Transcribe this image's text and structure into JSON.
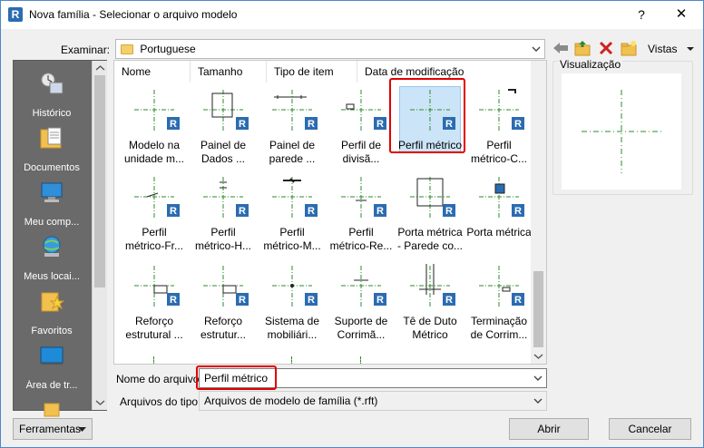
{
  "window": {
    "title": "Nova família - Selecionar o arquivo modelo",
    "help_label": "?",
    "close_label": "✕"
  },
  "lookin": {
    "label": "Examinar:",
    "value": "Portuguese"
  },
  "toolbar": {
    "views_label": "Vistas"
  },
  "places": [
    {
      "label": "Histórico",
      "icon": "history-icon"
    },
    {
      "label": "Documentos",
      "icon": "documents-icon"
    },
    {
      "label": "Meu comp...",
      "icon": "computer-icon"
    },
    {
      "label": "Meus locai...",
      "icon": "network-icon"
    },
    {
      "label": "Favoritos",
      "icon": "favorites-icon"
    },
    {
      "label": "Área de tr...",
      "icon": "desktop-icon"
    }
  ],
  "columns": [
    "Nome",
    "Tamanho",
    "Tipo de item",
    "Data de modificação"
  ],
  "files": [
    {
      "line1": "Modelo na",
      "line2": "unidade m..."
    },
    {
      "line1": "Painel de",
      "line2": "Dados ..."
    },
    {
      "line1": "Painel de",
      "line2": "parede ..."
    },
    {
      "line1": "Perfil de",
      "line2": "divisã..."
    },
    {
      "line1": "Perfil métrico",
      "line2": ""
    },
    {
      "line1": "Perfil",
      "line2": "métrico-C..."
    },
    {
      "line1": "Perfil",
      "line2": "métrico-Fr..."
    },
    {
      "line1": "Perfil",
      "line2": "métrico-H..."
    },
    {
      "line1": "Perfil",
      "line2": "métrico-M..."
    },
    {
      "line1": "Perfil",
      "line2": "métrico-Re..."
    },
    {
      "line1": "Porta métrica",
      "line2": "- Parede co..."
    },
    {
      "line1": "Porta métrica",
      "line2": ""
    },
    {
      "line1": "Reforço",
      "line2": "estrutural ..."
    },
    {
      "line1": "Reforço",
      "line2": "estrutur..."
    },
    {
      "line1": "Sistema de",
      "line2": "mobiliári..."
    },
    {
      "line1": "Suporte de",
      "line2": "Corrimã..."
    },
    {
      "line1": "Tê de Duto",
      "line2": "Métrico"
    },
    {
      "line1": "Terminação",
      "line2": "de Corrim..."
    }
  ],
  "preview": {
    "label": "Visualização"
  },
  "filename": {
    "label": "Nome do arquivo:",
    "value": "Perfil métrico"
  },
  "filetype": {
    "label": "Arquivos do tipo:",
    "value": "Arquivos de modelo de família  (*.rft)"
  },
  "buttons": {
    "tools": "Ferramentas",
    "open": "Abrir",
    "cancel": "Cancelar"
  },
  "colors": {
    "accent_border": "#4a88c8",
    "highlight": "#e00000",
    "selection": "#cce4f7",
    "dash_green": "#2e8b2e",
    "revit_blue": "#2b6cb0"
  }
}
